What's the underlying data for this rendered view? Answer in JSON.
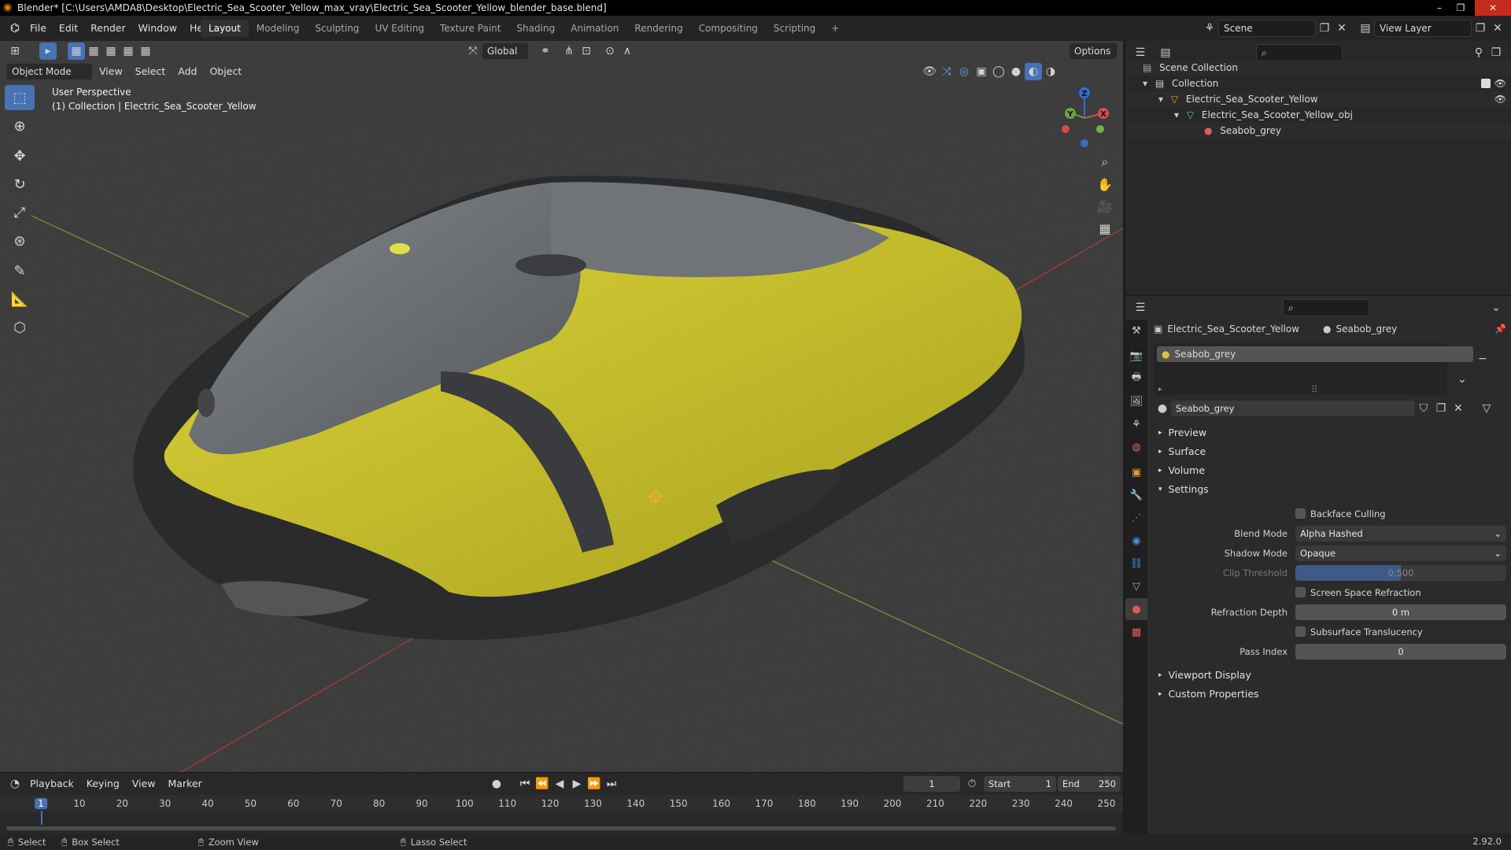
{
  "window": {
    "title": "Blender* [C:\\Users\\AMDA8\\Desktop\\Electric_Sea_Scooter_Yellow_max_vray\\Electric_Sea_Scooter_Yellow_blender_base.blend]",
    "minimize": "–",
    "maximize": "❐",
    "close": "✕"
  },
  "menubar": {
    "menus": [
      "File",
      "Edit",
      "Render",
      "Window",
      "Help"
    ],
    "workspaces": [
      "Layout",
      "Modeling",
      "Sculpting",
      "UV Editing",
      "Texture Paint",
      "Shading",
      "Animation",
      "Rendering",
      "Compositing",
      "Scripting"
    ],
    "add_workspace": "+",
    "scene_label": "Scene",
    "view_layer_label": "View Layer"
  },
  "viewport": {
    "transform_orientation": "Global",
    "options_label": "Options",
    "mode": "Object Mode",
    "menus": [
      "View",
      "Select",
      "Add",
      "Object"
    ],
    "info_line1": "User Perspective",
    "info_line2": "(1) Collection | Electric_Sea_Scooter_Yellow",
    "gizmo_axes": {
      "z": "Z",
      "y": "Y",
      "x": "X"
    }
  },
  "timeline": {
    "menus": [
      "Playback",
      "Keying",
      "View",
      "Marker"
    ],
    "current_frame": "1",
    "start_label": "Start",
    "start_value": "1",
    "end_label": "End",
    "end_value": "250",
    "ticks": [
      "1",
      "10",
      "20",
      "30",
      "40",
      "50",
      "60",
      "70",
      "80",
      "90",
      "100",
      "110",
      "120",
      "130",
      "140",
      "150",
      "160",
      "170",
      "180",
      "190",
      "200",
      "210",
      "220",
      "230",
      "240",
      "250"
    ]
  },
  "statusbar": {
    "select": "Select",
    "box_select": "Box Select",
    "zoom_view": "Zoom View",
    "lasso_select": "Lasso Select",
    "version": "2.92.0"
  },
  "outliner": {
    "rows": [
      {
        "label": "Scene Collection"
      },
      {
        "label": "Collection"
      },
      {
        "label": "Electric_Sea_Scooter_Yellow"
      },
      {
        "label": "Electric_Sea_Scooter_Yellow_obj"
      },
      {
        "label": "Seabob_grey"
      }
    ]
  },
  "properties": {
    "breadcrumb_object": "Electric_Sea_Scooter_Yellow",
    "breadcrumb_material": "Seabob_grey",
    "slot_name": "Seabob_grey",
    "material_name": "Seabob_grey",
    "panels": [
      "Preview",
      "Surface",
      "Volume",
      "Settings"
    ],
    "settings": {
      "backface_culling": "Backface Culling",
      "blend_mode_label": "Blend Mode",
      "blend_mode_value": "Alpha Hashed",
      "shadow_mode_label": "Shadow Mode",
      "shadow_mode_value": "Opaque",
      "clip_threshold_label": "Clip Threshold",
      "clip_threshold_value": "0.500",
      "screen_space_refraction": "Screen Space Refraction",
      "refraction_depth_label": "Refraction Depth",
      "refraction_depth_value": "0 m",
      "subsurface_translucency": "Subsurface Translucency",
      "pass_index_label": "Pass Index",
      "pass_index_value": "0"
    },
    "panels_bottom": [
      "Viewport Display",
      "Custom Properties"
    ]
  },
  "colors": {
    "accent": "#4772b3",
    "scooter_yellow": "#c9c22a",
    "scooter_grey": "#6b6e72"
  }
}
